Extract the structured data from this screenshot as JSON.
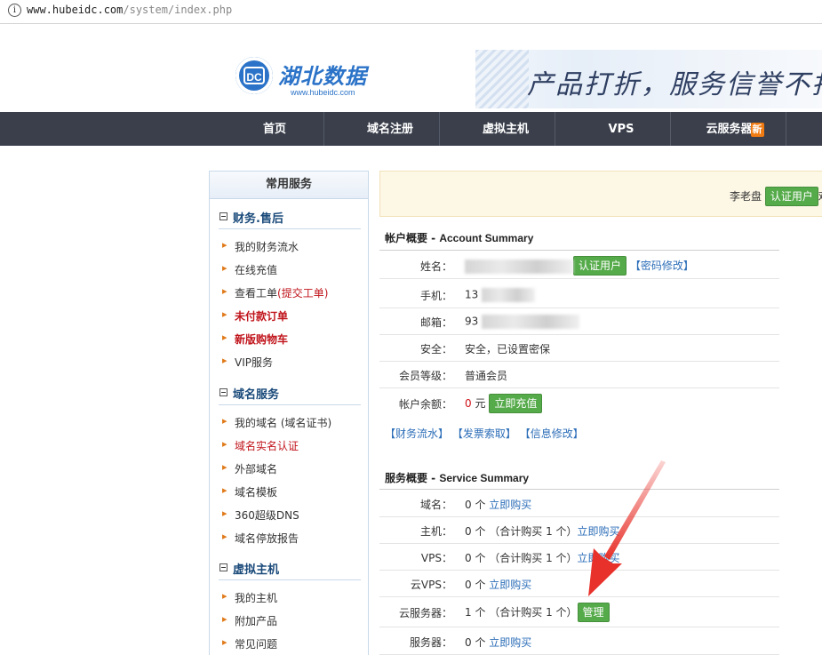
{
  "browser": {
    "url_host": "www.hubeidc.com",
    "url_path": "/system/index.php"
  },
  "logo": {
    "mark": "DC",
    "name": "湖北数据",
    "site": "www.hubeidc.com"
  },
  "banner": {
    "slogan": "产品打折，服务信誉不打"
  },
  "nav": {
    "items": [
      "首页",
      "域名注册",
      "虚拟主机",
      "VPS",
      "云服务器"
    ],
    "new_badge": "新"
  },
  "sidebar": {
    "title": "常用服务",
    "groups": [
      {
        "title": "财务.售后",
        "items": [
          {
            "label": "我的财务流水"
          },
          {
            "label": "在线充值"
          },
          {
            "label": "查看工单",
            "sub": "(提交工单)"
          },
          {
            "label": "未付款订单"
          },
          {
            "label": "新版购物车"
          },
          {
            "label": "VIP服务"
          }
        ]
      },
      {
        "title": "域名服务",
        "items": [
          {
            "label": "我的域名 (域名证书)"
          },
          {
            "label": "域名实名认证"
          },
          {
            "label": "外部域名"
          },
          {
            "label": "域名模板"
          },
          {
            "label": "360超级DNS"
          },
          {
            "label": "域名停放报告"
          }
        ]
      },
      {
        "title": "虚拟主机",
        "items": [
          {
            "label": "我的主机"
          },
          {
            "label": "附加产品"
          },
          {
            "label": "常见问题"
          }
        ]
      }
    ]
  },
  "notice": {
    "user": "李老盘",
    "verified": "认证用户",
    "tail": "欢"
  },
  "account": {
    "title_cn": "帐户概要 - ",
    "title_en": "Account Summary",
    "name_label": "姓名：",
    "verified_btn": "认证用户",
    "pwd_link": "【密码修改】",
    "phone_label": "手机：",
    "phone_value": "13",
    "email_label": "邮箱：",
    "email_value": "93",
    "security_label": "安全：",
    "security_value": "安全，已设置密保",
    "level_label": "会员等级：",
    "level_value": "普通会员",
    "balance_label": "帐户余额：",
    "balance_amount": "0",
    "balance_unit": "元",
    "recharge_btn": "立即充值",
    "links": [
      "【财务流水】",
      "【发票索取】",
      "【信息修改】"
    ]
  },
  "service": {
    "title_cn": "服务概要 - ",
    "title_en": "Service Summary",
    "rows": [
      {
        "label": "域名：",
        "count": "0 个",
        "detail": "",
        "action": "立即购买"
      },
      {
        "label": "主机：",
        "count": "0 个",
        "detail": "（合计购买 1 个）",
        "action": "立即购买"
      },
      {
        "label": "VPS：",
        "count": "0 个",
        "detail": "（合计购买 1 个）",
        "action": "立即购买"
      },
      {
        "label": "云VPS：",
        "count": "0 个",
        "detail": "",
        "action": "立即购买"
      },
      {
        "label": "云服务器：",
        "count": "1 个",
        "detail": "（合计购买 1 个）",
        "action": "管理"
      },
      {
        "label": "服务器：",
        "count": "0 个",
        "detail": "",
        "action": "立即购买"
      }
    ]
  },
  "colors": {
    "nav_bg": "#3a3f4b",
    "accent_green": "#55aa4a",
    "link_blue": "#2d6eb8",
    "annotation_red": "#e8312a"
  }
}
